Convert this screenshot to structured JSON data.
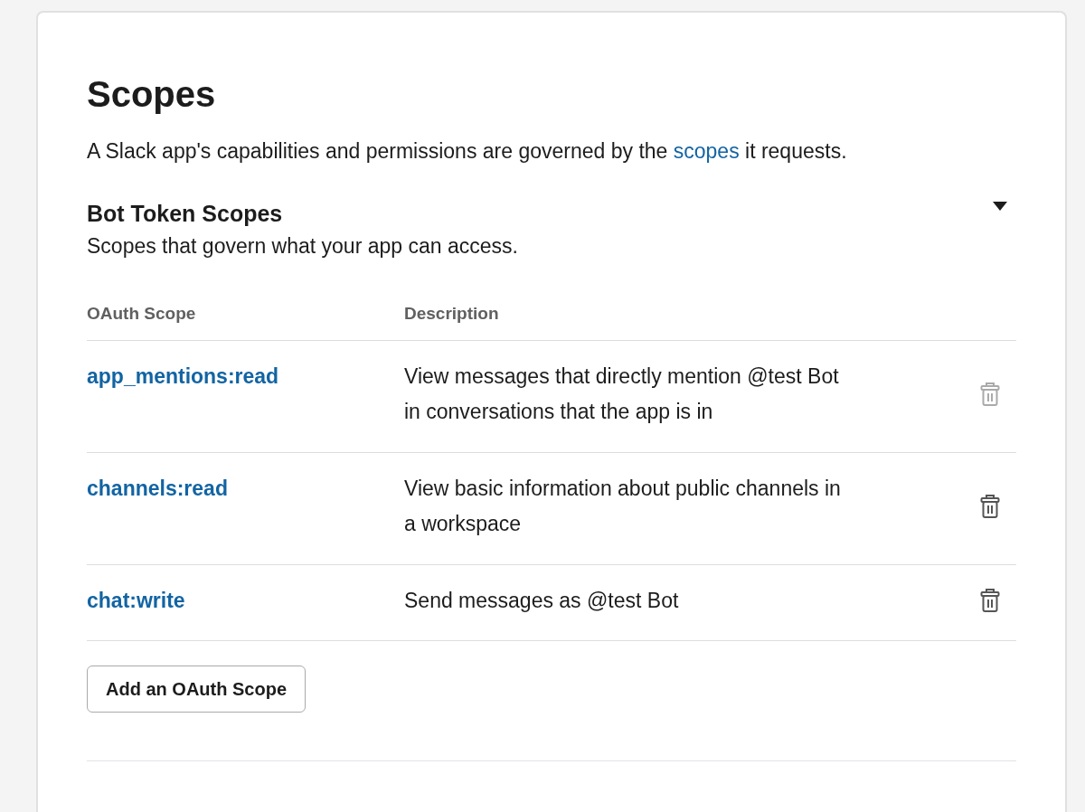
{
  "title": "Scopes",
  "intro": {
    "before": "A Slack app's capabilities and permissions are governed by the",
    "link": "scopes",
    "after": "it requests."
  },
  "section": {
    "title": "Bot Token Scopes",
    "subtitle": "Scopes that govern what your app can access.",
    "expanded": true
  },
  "table": {
    "columns": [
      "OAuth Scope",
      "Description"
    ],
    "rows": [
      {
        "scope": "app_mentions:read",
        "description": "View messages that directly mention @test Bot in conversations that the app is in",
        "disabled": true
      },
      {
        "scope": "channels:read",
        "description": "View basic information about public channels in a workspace",
        "disabled": false
      },
      {
        "scope": "chat:write",
        "description": "Send messages as @test Bot",
        "disabled": false
      }
    ]
  },
  "add_button": "Add an OAuth Scope"
}
